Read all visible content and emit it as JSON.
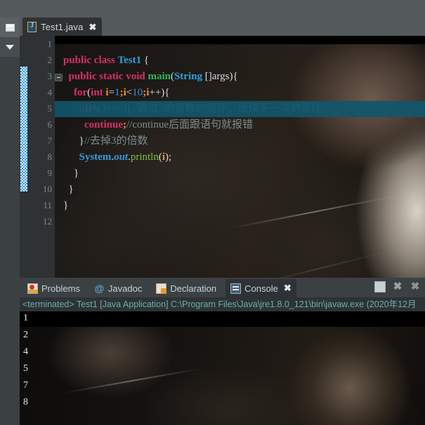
{
  "window": {
    "theme_bg": "#4e5356",
    "panel_bg": "#3b4043",
    "editor_bg": "#1b1a18"
  },
  "left_view_bar": {
    "restore_icon": "restore-icon",
    "dropdown_icon": "chevron-down-icon"
  },
  "editor": {
    "tab": {
      "label": "Test1.java",
      "close": "✖",
      "icon": "java-file-icon"
    },
    "gutter_lines": [
      "1",
      "2",
      "3",
      "4",
      "5",
      "6",
      "7",
      "8",
      "9",
      "10",
      "11",
      "12"
    ],
    "fold_marker_line": 3,
    "highlighted_line": 5,
    "code_lines": [
      {
        "n": 1,
        "tokens": []
      },
      {
        "n": 2,
        "tokens": [
          {
            "t": "public",
            "c": "k"
          },
          {
            "t": " ",
            "c": "pn"
          },
          {
            "t": "class",
            "c": "k"
          },
          {
            "t": " ",
            "c": "pn"
          },
          {
            "t": "Test1",
            "c": "ty"
          },
          {
            "t": " {",
            "c": "pn"
          }
        ]
      },
      {
        "n": 3,
        "tokens": [
          {
            "t": "  ",
            "c": "pn"
          },
          {
            "t": "public",
            "c": "k"
          },
          {
            "t": " ",
            "c": "pn"
          },
          {
            "t": "static",
            "c": "k"
          },
          {
            "t": " ",
            "c": "pn"
          },
          {
            "t": "void",
            "c": "k"
          },
          {
            "t": " ",
            "c": "pn"
          },
          {
            "t": "main",
            "c": "mn"
          },
          {
            "t": "(",
            "c": "pn"
          },
          {
            "t": "String",
            "c": "ty"
          },
          {
            "t": " []args){",
            "c": "pn"
          }
        ]
      },
      {
        "n": 4,
        "tokens": [
          {
            "t": "    ",
            "c": "pn"
          },
          {
            "t": "for",
            "c": "k"
          },
          {
            "t": "(",
            "c": "pn"
          },
          {
            "t": "int",
            "c": "k"
          },
          {
            "t": " ",
            "c": "pn"
          },
          {
            "t": "i",
            "c": "vr"
          },
          {
            "t": "=",
            "c": "pn"
          },
          {
            "t": "1",
            "c": "nu"
          },
          {
            "t": ";",
            "c": "vr"
          },
          {
            "t": "i",
            "c": "vr"
          },
          {
            "t": "<",
            "c": "pn"
          },
          {
            "t": "10",
            "c": "nu"
          },
          {
            "t": ";",
            "c": "vr"
          },
          {
            "t": "i",
            "c": "vr"
          },
          {
            "t": "++){",
            "c": "pn"
          }
        ]
      },
      {
        "n": 5,
        "tokens": [
          {
            "t": "      ",
            "c": "pn"
          },
          {
            "t": "if",
            "c": "k"
          },
          {
            "t": "(",
            "c": "pn"
          },
          {
            "t": "i",
            "c": "vr"
          },
          {
            "t": "%",
            "c": "pn"
          },
          {
            "t": "3",
            "c": "nu"
          },
          {
            "t": "==",
            "c": "pn"
          },
          {
            "t": "0",
            "c": "nu"
          },
          {
            "t": "){",
            "c": "pn"
          },
          {
            "t": "//跳过3的倍数的循环，继续下一次的循环",
            "c": "cm-hl"
          }
        ]
      },
      {
        "n": 6,
        "tokens": [
          {
            "t": "        ",
            "c": "pn"
          },
          {
            "t": "continue",
            "c": "k"
          },
          {
            "t": ";",
            "c": "vr"
          },
          {
            "t": "//continue后面跟语句就报错",
            "c": "cm"
          }
        ]
      },
      {
        "n": 7,
        "tokens": [
          {
            "t": "      ",
            "c": "pn"
          },
          {
            "t": "}",
            "c": "pn"
          },
          {
            "t": "//去掉3的倍数",
            "c": "cm"
          }
        ]
      },
      {
        "n": 8,
        "tokens": [
          {
            "t": "      ",
            "c": "pn"
          },
          {
            "t": "System",
            "c": "ty"
          },
          {
            "t": ".",
            "c": "pn"
          },
          {
            "t": "out",
            "c": "vf"
          },
          {
            "t": ".",
            "c": "pn"
          },
          {
            "t": "println",
            "c": "mi"
          },
          {
            "t": "(",
            "c": "pn"
          },
          {
            "t": "i",
            "c": "vr"
          },
          {
            "t": ");",
            "c": "pn"
          }
        ]
      },
      {
        "n": 9,
        "tokens": [
          {
            "t": "    }",
            "c": "pn"
          }
        ]
      },
      {
        "n": 10,
        "tokens": [
          {
            "t": "  }",
            "c": "pn"
          }
        ]
      },
      {
        "n": 11,
        "tokens": [
          {
            "t": "}",
            "c": "pn"
          }
        ]
      },
      {
        "n": 12,
        "tokens": []
      }
    ]
  },
  "panel": {
    "tabs": [
      {
        "label": "Problems",
        "icon": "problems-icon",
        "active": false
      },
      {
        "label": "Javadoc",
        "icon": "javadoc-icon",
        "active": false
      },
      {
        "label": "Declaration",
        "icon": "declaration-icon",
        "active": false
      },
      {
        "label": "Console",
        "icon": "console-icon",
        "active": true,
        "close": "✖"
      }
    ],
    "tools": [
      {
        "name": "minimize-restore-button",
        "glyph": ""
      },
      {
        "name": "close-button",
        "glyph": "✖"
      },
      {
        "name": "remove-all-terminated-button",
        "glyph": "✖"
      }
    ],
    "status_line": "<terminated> Test1 [Java Application] C:\\Program Files\\Java\\jre1.8.0_121\\bin\\javaw.exe (2020年12月",
    "status_color": "#64b0b0",
    "output_lines": [
      "1",
      "2",
      "4",
      "5",
      "7",
      "8"
    ]
  }
}
